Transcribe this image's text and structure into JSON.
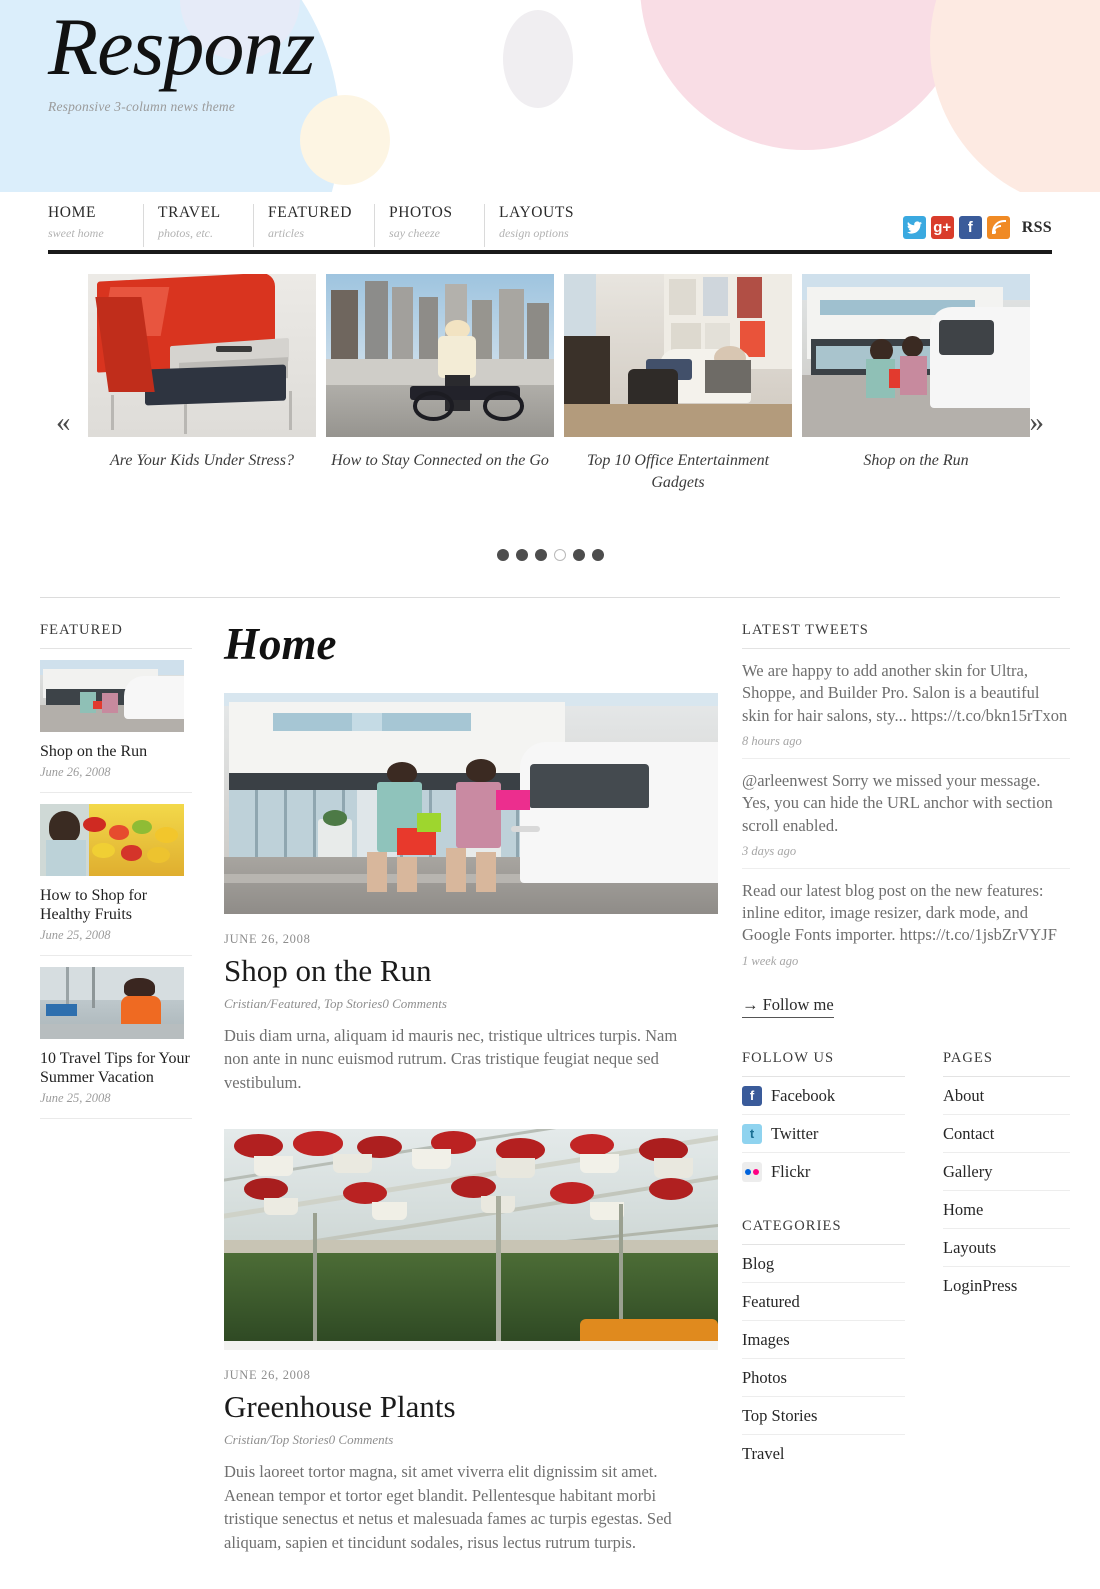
{
  "site": {
    "title": "Responz",
    "tagline": "Responsive 3-column news theme"
  },
  "nav": {
    "items": [
      {
        "label": "HOME",
        "sub": "sweet home"
      },
      {
        "label": "TRAVEL",
        "sub": "photos, etc."
      },
      {
        "label": "FEATURED",
        "sub": "articles"
      },
      {
        "label": "PHOTOS",
        "sub": "say cheeze"
      },
      {
        "label": "LAYOUTS",
        "sub": "design options"
      }
    ]
  },
  "social": {
    "twitter_glyph": "❮",
    "twitter_label": "t",
    "gplus_label": "g+",
    "facebook_label": "f",
    "rss_label": "RSS",
    "colors": {
      "twitter": "#3aa9e0",
      "gplus": "#d93c2b",
      "facebook": "#3a5b9a",
      "rss": "#f08a24"
    }
  },
  "carousel": {
    "prev_glyph": "«",
    "next_glyph": "»",
    "slides": [
      {
        "caption": "Are Your Kids Under Stress?"
      },
      {
        "caption": "How to Stay Connected on the Go"
      },
      {
        "caption": "Top 10 Office Entertainment Gadgets"
      },
      {
        "caption": "Shop on the Run"
      }
    ],
    "dot_count": 6,
    "active_dot": 4
  },
  "featured_widget": {
    "title": "FEATURED",
    "items": [
      {
        "title": "Shop on the Run",
        "date": "June 26, 2008"
      },
      {
        "title": "How to Shop for Healthy Fruits",
        "date": "June 25, 2008"
      },
      {
        "title": "10 Travel Tips for Your Summer Vacation",
        "date": "June 25, 2008"
      }
    ]
  },
  "main": {
    "page_title": "Home",
    "posts": [
      {
        "date": "JUNE 26, 2008",
        "title": "Shop on the Run",
        "author": "Cristian",
        "sep": "/",
        "categories": "Featured, Top Stories",
        "comments": "0 Comments",
        "excerpt": "Duis diam urna, aliquam id mauris nec, tristique ultrices turpis. Nam non ante in nunc euismod rutrum. Cras tristique feugiat neque sed vestibulum."
      },
      {
        "date": "JUNE 26, 2008",
        "title": "Greenhouse Plants",
        "author": "Cristian",
        "sep": "/",
        "categories": "Top Stories",
        "comments": "0 Comments",
        "excerpt": "Duis laoreet tortor magna, sit amet viverra elit dignissim sit amet. Aenean tempor et tortor eget blandit. Pellentesque habitant morbi tristique senectus et netus et malesuada fames ac turpis egestas. Sed aliquam, sapien et tincidunt sodales, risus lectus rutrum turpis."
      }
    ]
  },
  "tweets_widget": {
    "title": "LATEST TWEETS",
    "items": [
      {
        "text": "We are happy to add another skin for Ultra, Shoppe, and Builder Pro. Salon is a beautiful skin for hair salons, sty... https://t.co/bkn15rTxon",
        "time": "8 hours ago"
      },
      {
        "text": "@arleenwest Sorry we missed your message. Yes, you can hide the URL anchor with section scroll enabled.",
        "time": "3 days ago"
      },
      {
        "text": "Read our latest blog post on the new features: inline editor, image resizer, dark mode, and Google Fonts importer. https://t.co/1jsbZrVYJF",
        "time": "1 week ago"
      }
    ],
    "follow_label": "→ Follow me"
  },
  "follow_widget": {
    "title": "FOLLOW US",
    "items": [
      {
        "label": "Facebook",
        "icon": "facebook-icon"
      },
      {
        "label": "Twitter",
        "icon": "twitter-icon"
      },
      {
        "label": "Flickr",
        "icon": "flickr-icon"
      }
    ]
  },
  "categories_widget": {
    "title": "CATEGORIES",
    "items": [
      "Blog",
      "Featured",
      "Images",
      "Photos",
      "Top Stories",
      "Travel"
    ]
  },
  "pages_widget": {
    "title": "PAGES",
    "items": [
      "About",
      "Contact",
      "Gallery",
      "Home",
      "Layouts",
      "LoginPress"
    ]
  }
}
